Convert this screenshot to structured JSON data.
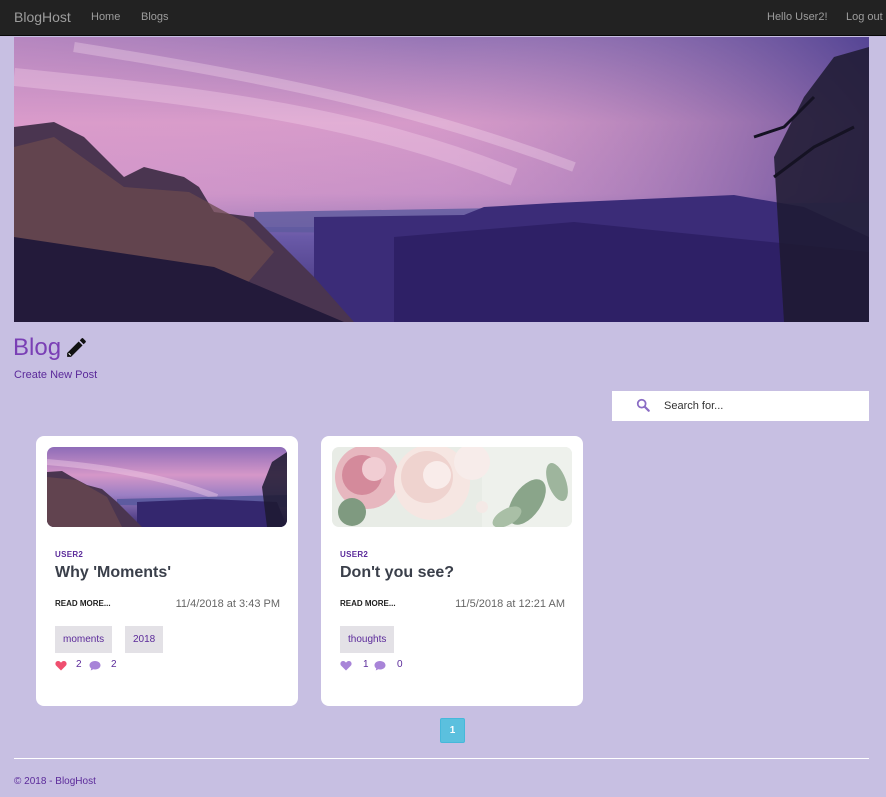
{
  "navbar": {
    "brand": "BlogHost",
    "links": [
      "Home",
      "Blogs"
    ],
    "greeting": "Hello User2!",
    "logout": "Log out"
  },
  "blog": {
    "title": "Blog",
    "create_link": "Create New Post"
  },
  "search": {
    "placeholder": "Search for..."
  },
  "posts": [
    {
      "author": "USER2",
      "title": "Why 'Moments'",
      "read_more": "READ MORE...",
      "date": "11/4/2018 at 3:43 PM",
      "tags": [
        "moments",
        "2018"
      ],
      "likes": "2",
      "comments": "2",
      "liked": true
    },
    {
      "author": "USER2",
      "title": "Don't you see?",
      "read_more": "READ MORE...",
      "date": "11/5/2018 at 12:21 AM",
      "tags": [
        "thoughts"
      ],
      "likes": "1",
      "comments": "0",
      "liked": false
    }
  ],
  "pagination": {
    "current_page": "1"
  },
  "footer": {
    "text": "© 2018 - BlogHost"
  },
  "colors": {
    "navbar": "#222222",
    "page_bg": "#c7bfe2",
    "accent_purple": "#7a3fb5",
    "liked_heart": "#ef4f6f",
    "unliked_heart": "#a884d8",
    "pagination": "#5bc0de"
  }
}
